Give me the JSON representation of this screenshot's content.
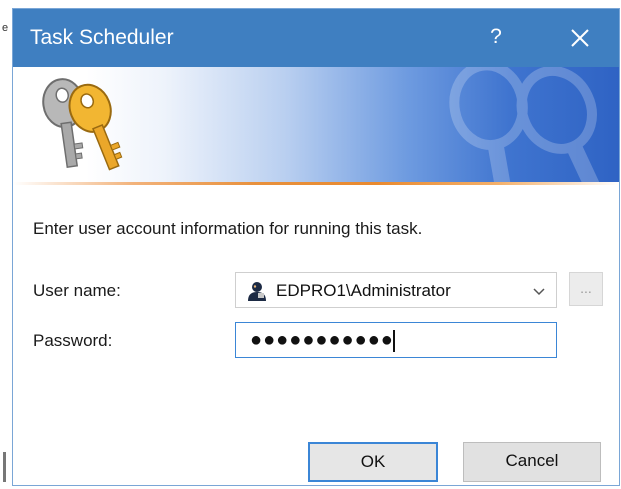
{
  "window": {
    "title": "Task Scheduler",
    "help_label": "?",
    "close_icon": "close-icon",
    "help_icon": "help-icon"
  },
  "banner": {
    "icon": "keys-icon",
    "accent_colors": {
      "title_bar": "#3f7fc1",
      "banner_blue": "#2f63c4",
      "orange_line": "#e98a2f"
    }
  },
  "form": {
    "prompt": "Enter user account information for running this task.",
    "user_label": "User name:",
    "user_value": "EDPRO1\\Administrator",
    "user_icon": "user-icon",
    "browse_label": "...",
    "password_label": "Password:",
    "password_masked": "●●●●●●●●●●●"
  },
  "buttons": {
    "ok": "OK",
    "cancel": "Cancel"
  },
  "left_edge_text": "e"
}
